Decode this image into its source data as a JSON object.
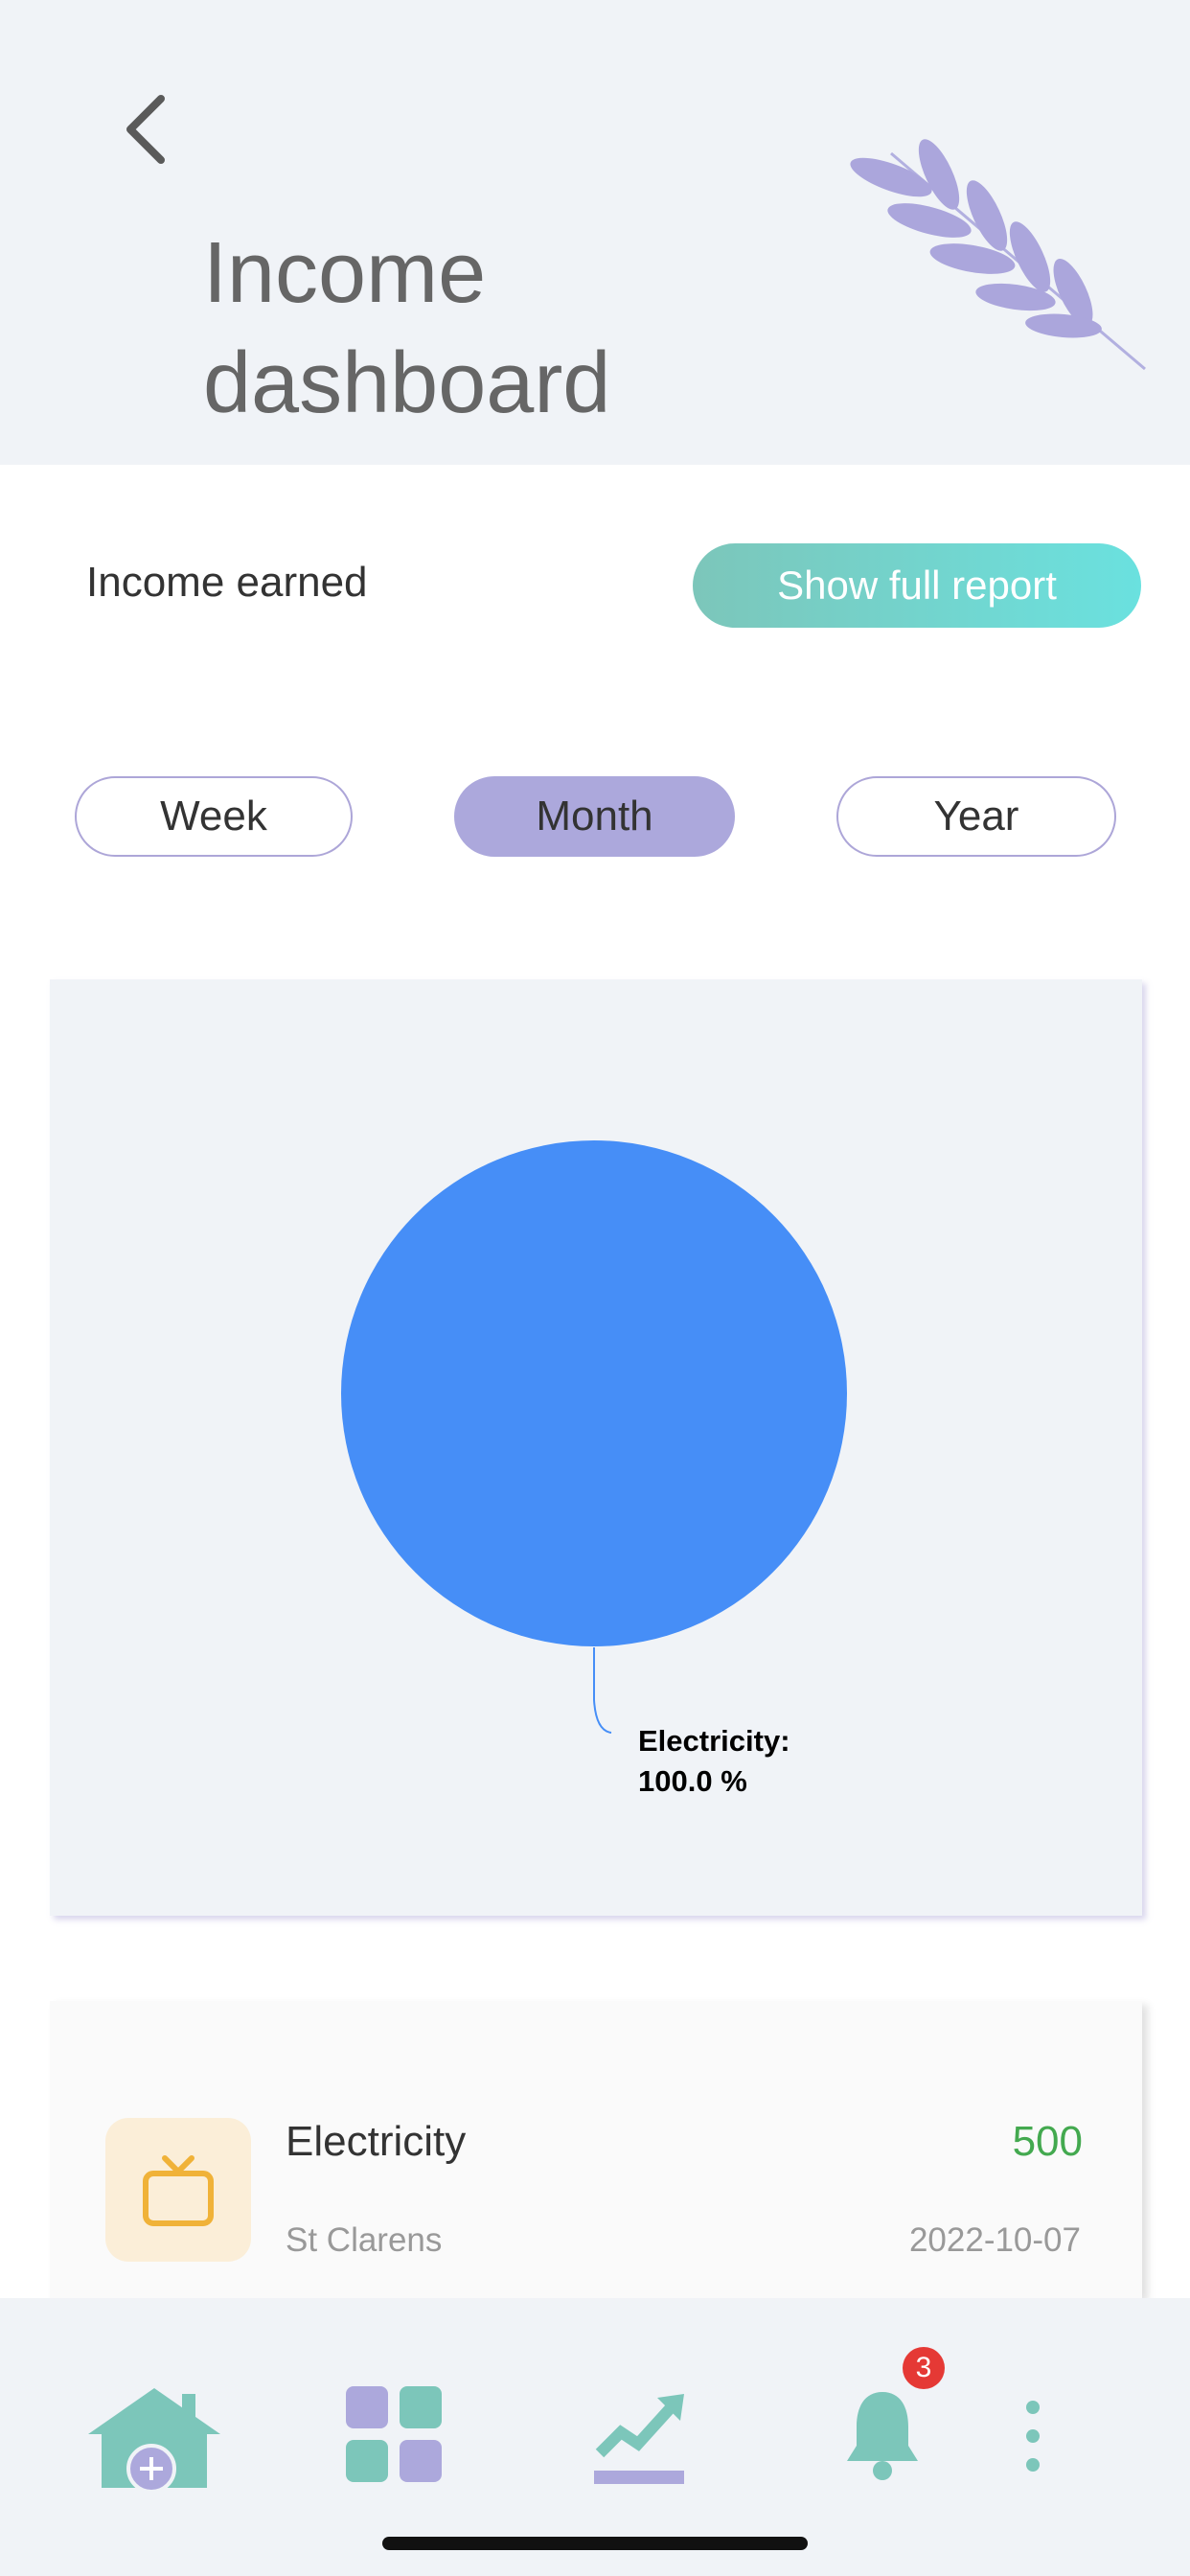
{
  "header": {
    "title_line1": "Income",
    "title_line2": "dashboard"
  },
  "summary": {
    "label": "Income earned",
    "report_button": "Show full report"
  },
  "range_tabs": [
    {
      "label": "Week",
      "active": false
    },
    {
      "label": "Month",
      "active": true
    },
    {
      "label": "Year",
      "active": false
    }
  ],
  "chart_data": {
    "type": "pie",
    "slices": [
      {
        "label": "Electricity",
        "value": 100.0,
        "color": "#468ef7"
      }
    ],
    "labels": {
      "name_line": "Electricity:",
      "percent_line": "100.0 %"
    }
  },
  "transactions": [
    {
      "title": "Electricity",
      "location": "St Clarens",
      "amount": "500",
      "date": "2022-10-07",
      "icon": "tv-icon"
    }
  ],
  "nav": {
    "items": [
      "home-icon",
      "grid-icon",
      "chart-icon",
      "bell-icon",
      "more-icon"
    ],
    "notification_count": "3"
  },
  "colors": {
    "accent_teal": "#7cc6ba",
    "accent_purple": "#aca8dc",
    "chart_blue": "#468ef7",
    "amount_green": "#43a94f",
    "badge_red": "#e53935"
  }
}
